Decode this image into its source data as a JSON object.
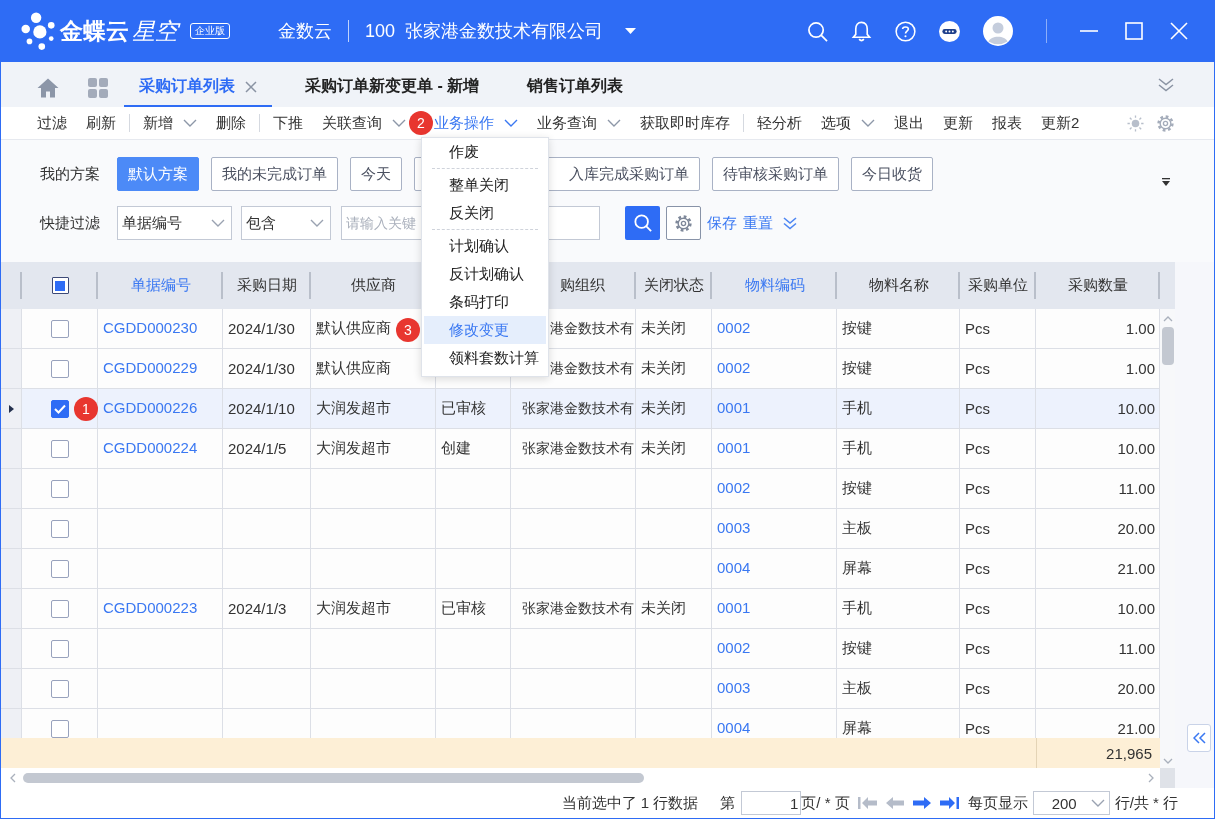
{
  "header": {
    "product": "金蝶云",
    "edition_name": "星空",
    "edition_tag": "企业版",
    "tenant": "金数云",
    "org_code": "100",
    "org_name": "张家港金数技术有限公司"
  },
  "tabs": [
    {
      "label": "采购订单列表",
      "selected": true,
      "closable": true
    },
    {
      "label": "采购订单新变更单 - 新增",
      "selected": false,
      "closable": false
    },
    {
      "label": "销售订单列表",
      "selected": false,
      "closable": false
    }
  ],
  "toolbar": {
    "groups": [
      [
        {
          "label": "过滤",
          "dropdown": false,
          "open": false
        },
        {
          "label": "刷新",
          "dropdown": false,
          "open": false
        }
      ],
      [
        {
          "label": "新增",
          "dropdown": true,
          "open": false
        },
        {
          "label": "删除",
          "dropdown": false,
          "open": false
        }
      ],
      [
        {
          "label": "下推",
          "dropdown": false,
          "open": false
        },
        {
          "label": "关联查询",
          "dropdown": true,
          "open": false
        },
        {
          "label": "业务操作",
          "dropdown": true,
          "open": true,
          "marker": "2"
        },
        {
          "label": "业务查询",
          "dropdown": true,
          "open": false
        },
        {
          "label": "获取即时库存",
          "dropdown": false,
          "open": false
        }
      ],
      [
        {
          "label": "轻分析",
          "dropdown": false,
          "open": false
        },
        {
          "label": "选项",
          "dropdown": true,
          "open": false
        },
        {
          "label": "退出",
          "dropdown": false,
          "open": false
        },
        {
          "label": "更新",
          "dropdown": false,
          "open": false
        },
        {
          "label": "报表",
          "dropdown": false,
          "open": false
        },
        {
          "label": "更新2",
          "dropdown": false,
          "open": false
        }
      ]
    ]
  },
  "menu": {
    "groups": [
      [
        {
          "label": "作废",
          "selected": false
        }
      ],
      [
        {
          "label": "整单关闭",
          "selected": false
        },
        {
          "label": "反关闭",
          "selected": false
        }
      ],
      [
        {
          "label": "计划确认",
          "selected": false
        },
        {
          "label": "反计划确认",
          "selected": false
        },
        {
          "label": "条码打印",
          "selected": false
        },
        {
          "label": "修改变更",
          "selected": true,
          "marker": "3"
        },
        {
          "label": "领料套数计算",
          "selected": false
        }
      ]
    ]
  },
  "schemes": {
    "label": "我的方案",
    "items": [
      {
        "label": "默认方案",
        "selected": true
      },
      {
        "label": "我的未完成订单",
        "selected": false
      },
      {
        "label": "今天",
        "selected": false
      },
      {
        "label": "入库完成采购订单",
        "selected": false
      },
      {
        "label": "待审核采购订单",
        "selected": false
      },
      {
        "label": "今日收货",
        "selected": false
      }
    ]
  },
  "quick_filter": {
    "label": "快捷过滤",
    "field": "单据编号",
    "operator": "包含",
    "placeholder": "请输入关键",
    "save": "保存",
    "reset": "重置"
  },
  "table": {
    "select_all": {
      "indeterminate": true
    },
    "columns": [
      {
        "label": "单据编号",
        "kind": "link"
      },
      {
        "label": "采购日期",
        "kind": "text"
      },
      {
        "label": "供应商",
        "kind": "text"
      },
      {
        "kind": "text"
      },
      {
        "label": "购组织",
        "kind": "text"
      },
      {
        "label": "关闭状态",
        "kind": "text"
      },
      {
        "label": "物料编码",
        "kind": "link"
      },
      {
        "label": "物料名称",
        "kind": "text"
      },
      {
        "label": "采购单位",
        "kind": "text"
      },
      {
        "label": "采购数量",
        "kind": "number"
      }
    ],
    "rows": [
      {
        "checked": false,
        "selected": false,
        "number": "CGDD000230",
        "date": "2024/1/30",
        "supplier": "默认供应商",
        "column_5": "港金数技术有",
        "close_status": "未关闭",
        "material_code": "0002",
        "material_name": "按键",
        "unit": "Pcs",
        "quantity": "1.00"
      },
      {
        "checked": false,
        "selected": false,
        "number": "CGDD000229",
        "date": "2024/1/30",
        "supplier": "默认供应商",
        "column_5": "港金数技术有",
        "close_status": "未关闭",
        "material_code": "0002",
        "material_name": "按键",
        "unit": "Pcs",
        "quantity": "1.00"
      },
      {
        "checked": true,
        "selected": true,
        "marker": "1",
        "number": "CGDD000226",
        "date": "2024/1/10",
        "supplier": "大润发超市",
        "column_4": "已审核",
        "column_5": "张家港金数技术有",
        "close_status": "未关闭",
        "material_code": "0001",
        "material_name": "手机",
        "unit": "Pcs",
        "quantity": "10.00"
      },
      {
        "checked": false,
        "selected": false,
        "number": "CGDD000224",
        "date": "2024/1/5",
        "supplier": "大润发超市",
        "column_4": "创建",
        "column_5": "张家港金数技术有",
        "close_status": "未关闭",
        "material_code": "0001",
        "material_name": "手机",
        "unit": "Pcs",
        "quantity": "10.00"
      },
      {
        "checked": false,
        "selected": false,
        "material_code": "0002",
        "material_name": "按键",
        "unit": "Pcs",
        "quantity": "11.00"
      },
      {
        "checked": false,
        "selected": false,
        "material_code": "0003",
        "material_name": "主板",
        "unit": "Pcs",
        "quantity": "20.00"
      },
      {
        "checked": false,
        "selected": false,
        "material_code": "0004",
        "material_name": "屏幕",
        "unit": "Pcs",
        "quantity": "21.00"
      },
      {
        "checked": false,
        "selected": false,
        "number": "CGDD000223",
        "date": "2024/1/3",
        "supplier": "大润发超市",
        "column_4": "已审核",
        "column_5": "张家港金数技术有",
        "close_status": "未关闭",
        "material_code": "0001",
        "material_name": "手机",
        "unit": "Pcs",
        "quantity": "10.00"
      },
      {
        "checked": false,
        "selected": false,
        "material_code": "0002",
        "material_name": "按键",
        "unit": "Pcs",
        "quantity": "11.00"
      },
      {
        "checked": false,
        "selected": false,
        "material_code": "0003",
        "material_name": "主板",
        "unit": "Pcs",
        "quantity": "20.00"
      },
      {
        "checked": false,
        "selected": false,
        "material_code": "0004",
        "material_name": "屏幕",
        "unit": "Pcs",
        "quantity": "21.00"
      }
    ],
    "totals": {
      "quantity": "21,965"
    }
  },
  "pagination": {
    "selection_text": "当前选中了 1 行数据",
    "page_prefix": "第",
    "page": "1",
    "page_suffix": "页/ * 页",
    "nav": [
      {
        "kind": "first",
        "disabled": true
      },
      {
        "kind": "prev",
        "disabled": true
      },
      {
        "kind": "next",
        "disabled": false
      },
      {
        "kind": "last",
        "disabled": false
      }
    ],
    "page_size_label": "每页显示",
    "page_size": "200",
    "total_text": "行/共 * 行"
  }
}
